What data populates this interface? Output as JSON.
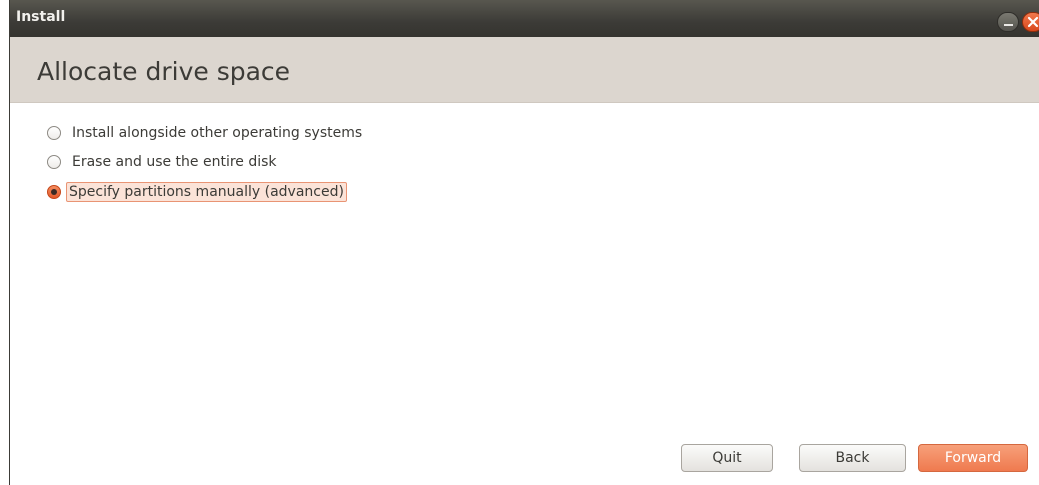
{
  "window": {
    "title": "Install",
    "controls": {
      "minimize": "minimize-icon",
      "close": "close-icon"
    }
  },
  "page": {
    "title": "Allocate drive space"
  },
  "options": [
    {
      "label": "Install alongside other operating systems",
      "checked": false
    },
    {
      "label": "Erase and use the entire disk",
      "checked": false
    },
    {
      "label": "Specify partitions manually (advanced)",
      "checked": true
    }
  ],
  "buttons": {
    "quit": "Quit",
    "back": "Back",
    "forward": "Forward"
  },
  "colors": {
    "accent": "#ef7a4f",
    "titlebar": "#3c3b37",
    "header": "#dcd6cf"
  }
}
